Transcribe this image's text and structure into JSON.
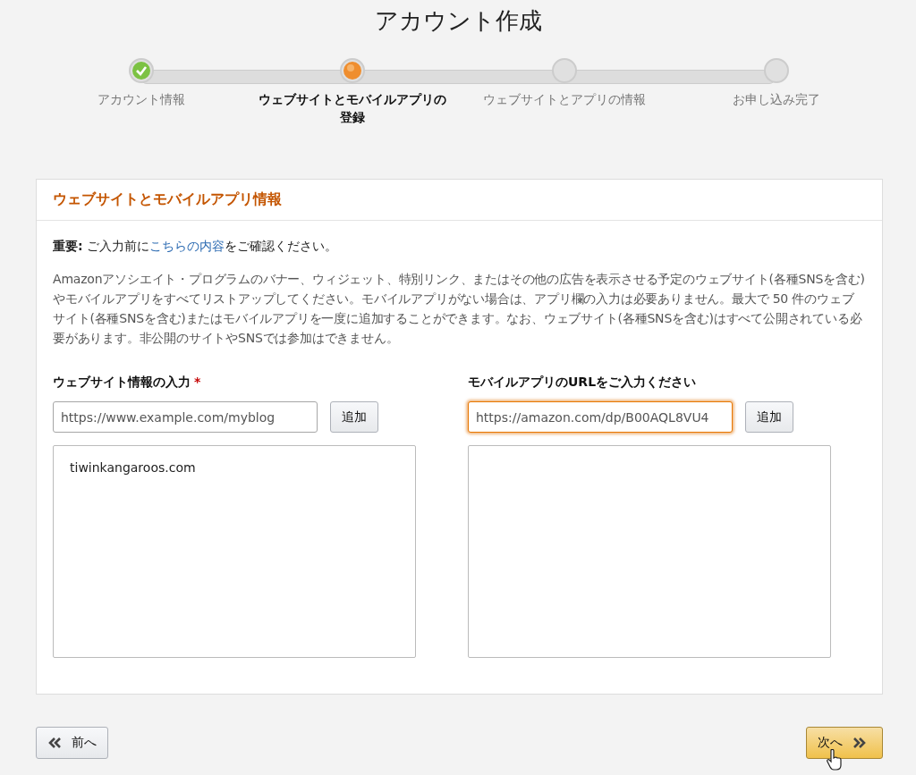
{
  "page_title": "アカウント作成",
  "steps": [
    {
      "label": "アカウント情報",
      "completed": true,
      "current": false
    },
    {
      "label": "ウェブサイトとモバイルアプリの登録",
      "completed": false,
      "current": true
    },
    {
      "label": "ウェブサイトとアプリの情報",
      "completed": false,
      "current": false
    },
    {
      "label": "お申し込み完了",
      "completed": false,
      "current": false
    }
  ],
  "card": {
    "title": "ウェブサイトとモバイルアプリ情報",
    "notice": {
      "lead": "**重要:** ご入力前に",
      "link": "こちらの内容",
      "tail": "をご確認ください。"
    },
    "description": "Amazonアソシエイト・プログラムのバナー、ウィジェット、特別リンク、またはその他の広告を表示させる予定のウェブサイト(各種SNSを含む)やモバイルアプリをすべてリストアップしてください。モバイルアプリがない場合は、アプリ欄の入力は必要ありません。最大で 50 件のウェブサイト(各種SNSを含む)またはモバイルアプリを一度に追加することができます。なお、ウェブサイト(各種SNSを含む)はすべて公開されている必要があります。非公開のサイトやSNSでは参加はできません。",
    "columns": [
      {
        "label": "ウェブサイト情報の入力",
        "required_mark": "*",
        "placeholder": "https://www.example.com/myblog",
        "focused": false,
        "button": "追加",
        "items": [
          "tiwinkangaroos.com"
        ]
      },
      {
        "label": "モバイルアプリのURLをご入力ください",
        "placeholder": "https://amazon.com/dp/B00AQL8VU4",
        "focused": true,
        "button": "追加"
      }
    ]
  },
  "back_button": "前へ",
  "next_button": "次へ"
}
